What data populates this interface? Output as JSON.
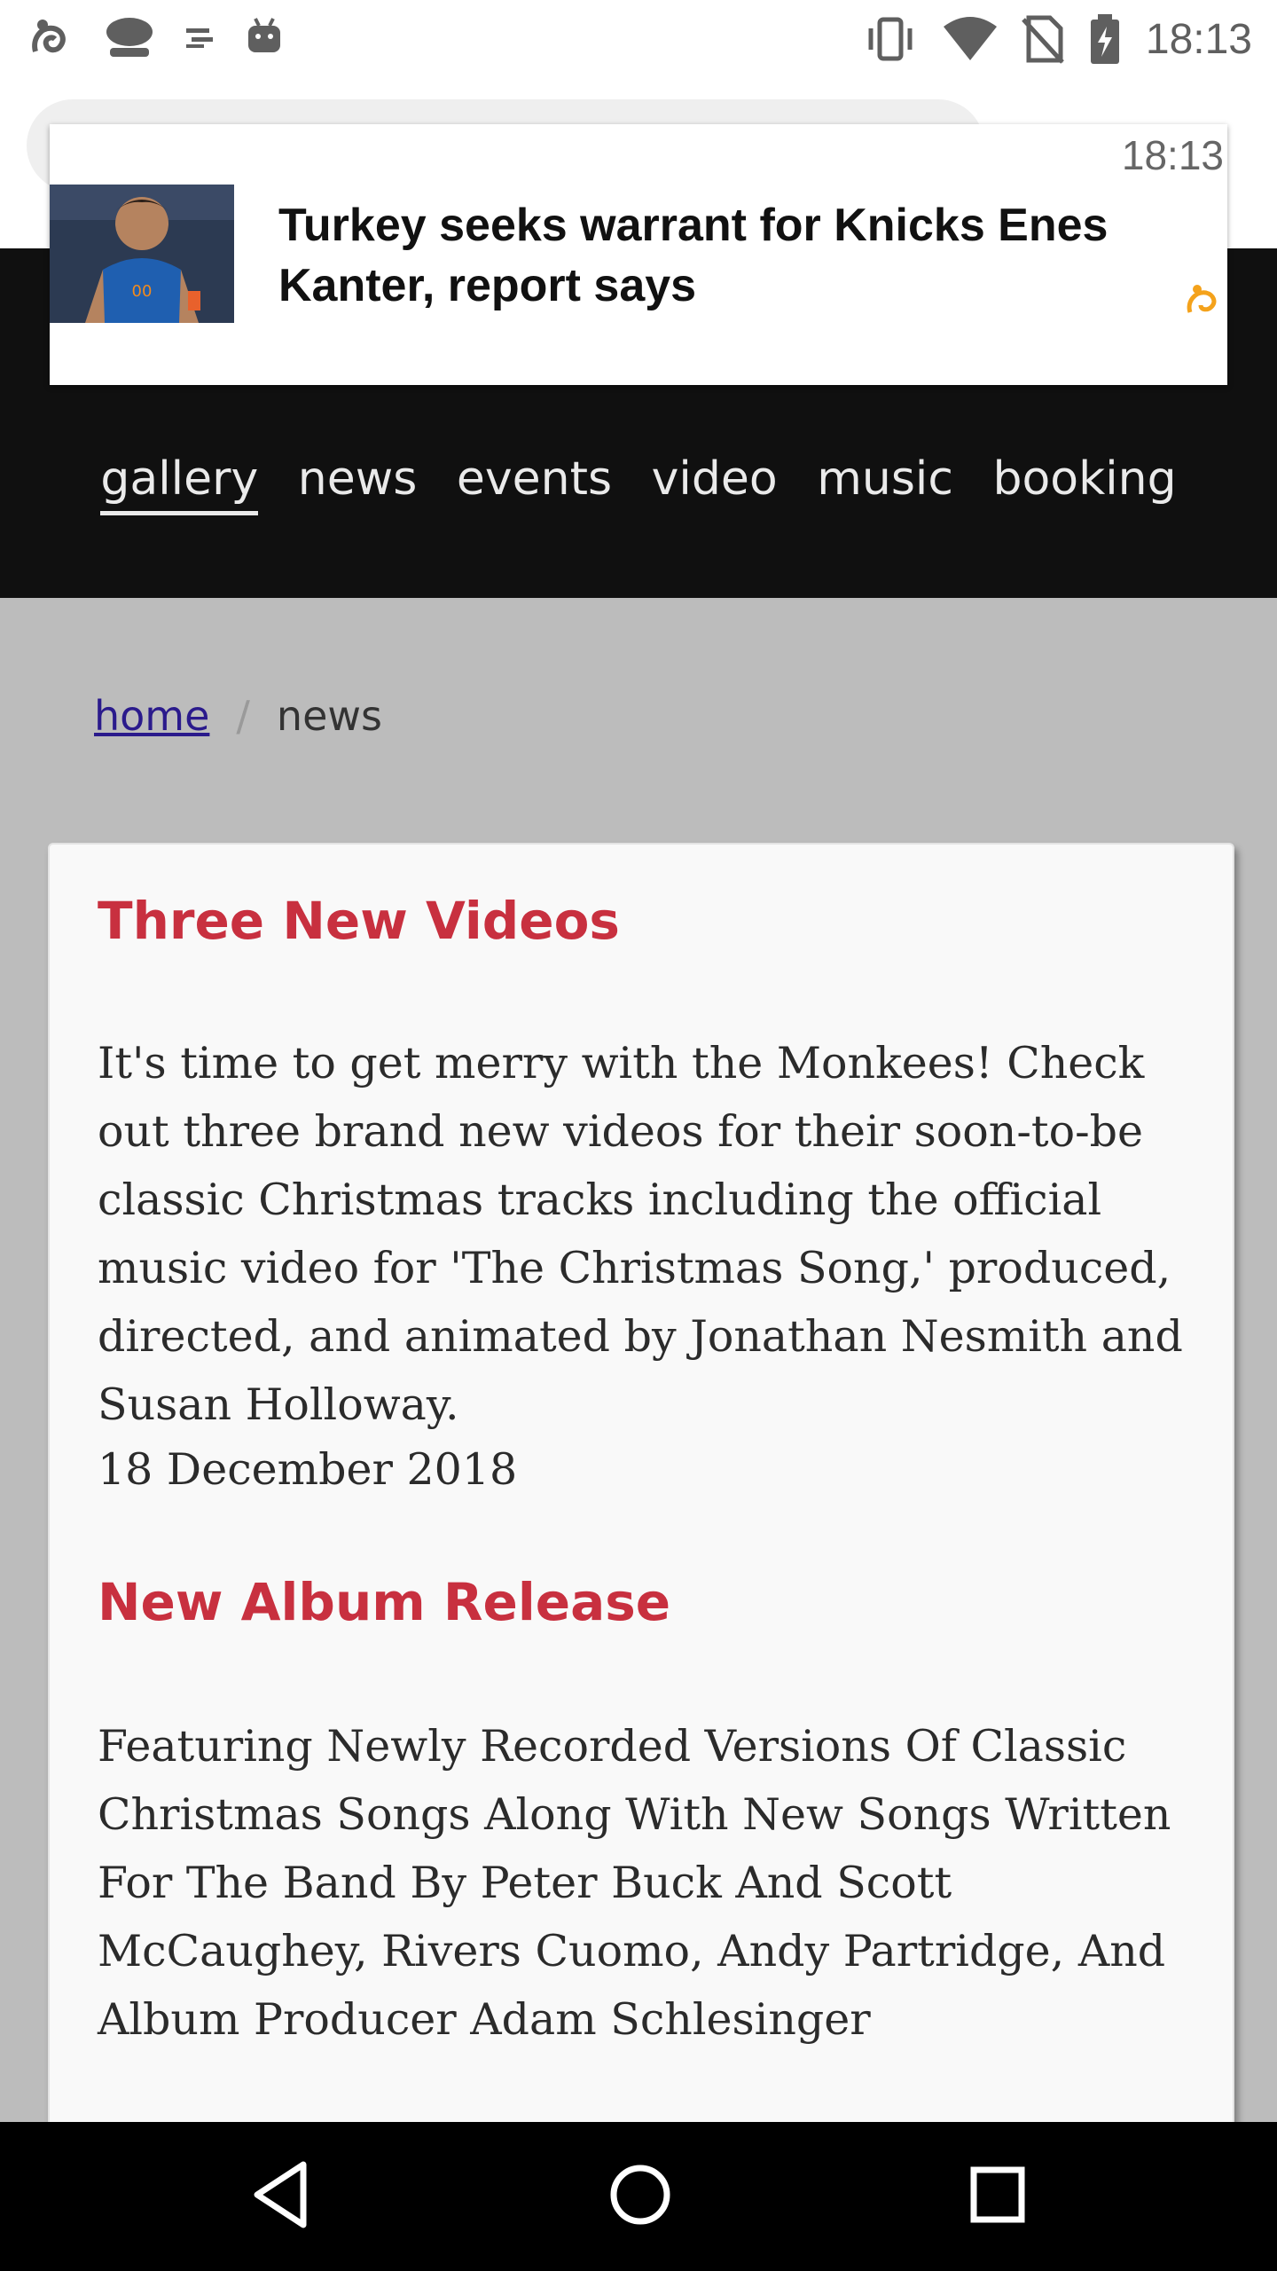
{
  "status_bar": {
    "time": "18:13",
    "left_icons": [
      "uc-browser-icon",
      "joystick-icon",
      "usb-icon",
      "android-icon"
    ],
    "right_icons": [
      "vibrate-icon",
      "wifi-icon",
      "no-sim-icon",
      "battery-charging-icon"
    ]
  },
  "notification": {
    "time": "18:13",
    "title": "Turkey seeks warrant for Knicks Enes Kanter, report says",
    "app_icon": "uc-browser-icon"
  },
  "nav": {
    "items": [
      "gallery",
      "news",
      "events",
      "video",
      "music",
      "booking"
    ],
    "active": "gallery"
  },
  "breadcrumb": {
    "home": "home",
    "separator": "/",
    "current": "news"
  },
  "articles": [
    {
      "title": "Three New Videos",
      "body": "It's time to get merry with the Monkees! Check out three brand new videos for their soon-to-be classic Christmas tracks including the official music video for 'The Christmas Song,' produced, directed, and animated by Jonathan Nesmith and Susan Holloway.",
      "date": "18 December 2018"
    },
    {
      "title": "New Album Release",
      "body": "Featuring Newly Recorded Versions Of Classic Christmas Songs Along With New Songs Written For The Band By Peter Buck And Scott McCaughey, Rivers Cuomo, Andy Partridge, And Album Producer Adam Schlesinger"
    }
  ],
  "colors": {
    "accent_title": "#c8303f",
    "header_bg": "#101010",
    "page_bg": "#bcbcbc",
    "link": "#2a1a8c"
  },
  "system_nav": [
    "back-icon",
    "home-icon",
    "recents-icon"
  ]
}
